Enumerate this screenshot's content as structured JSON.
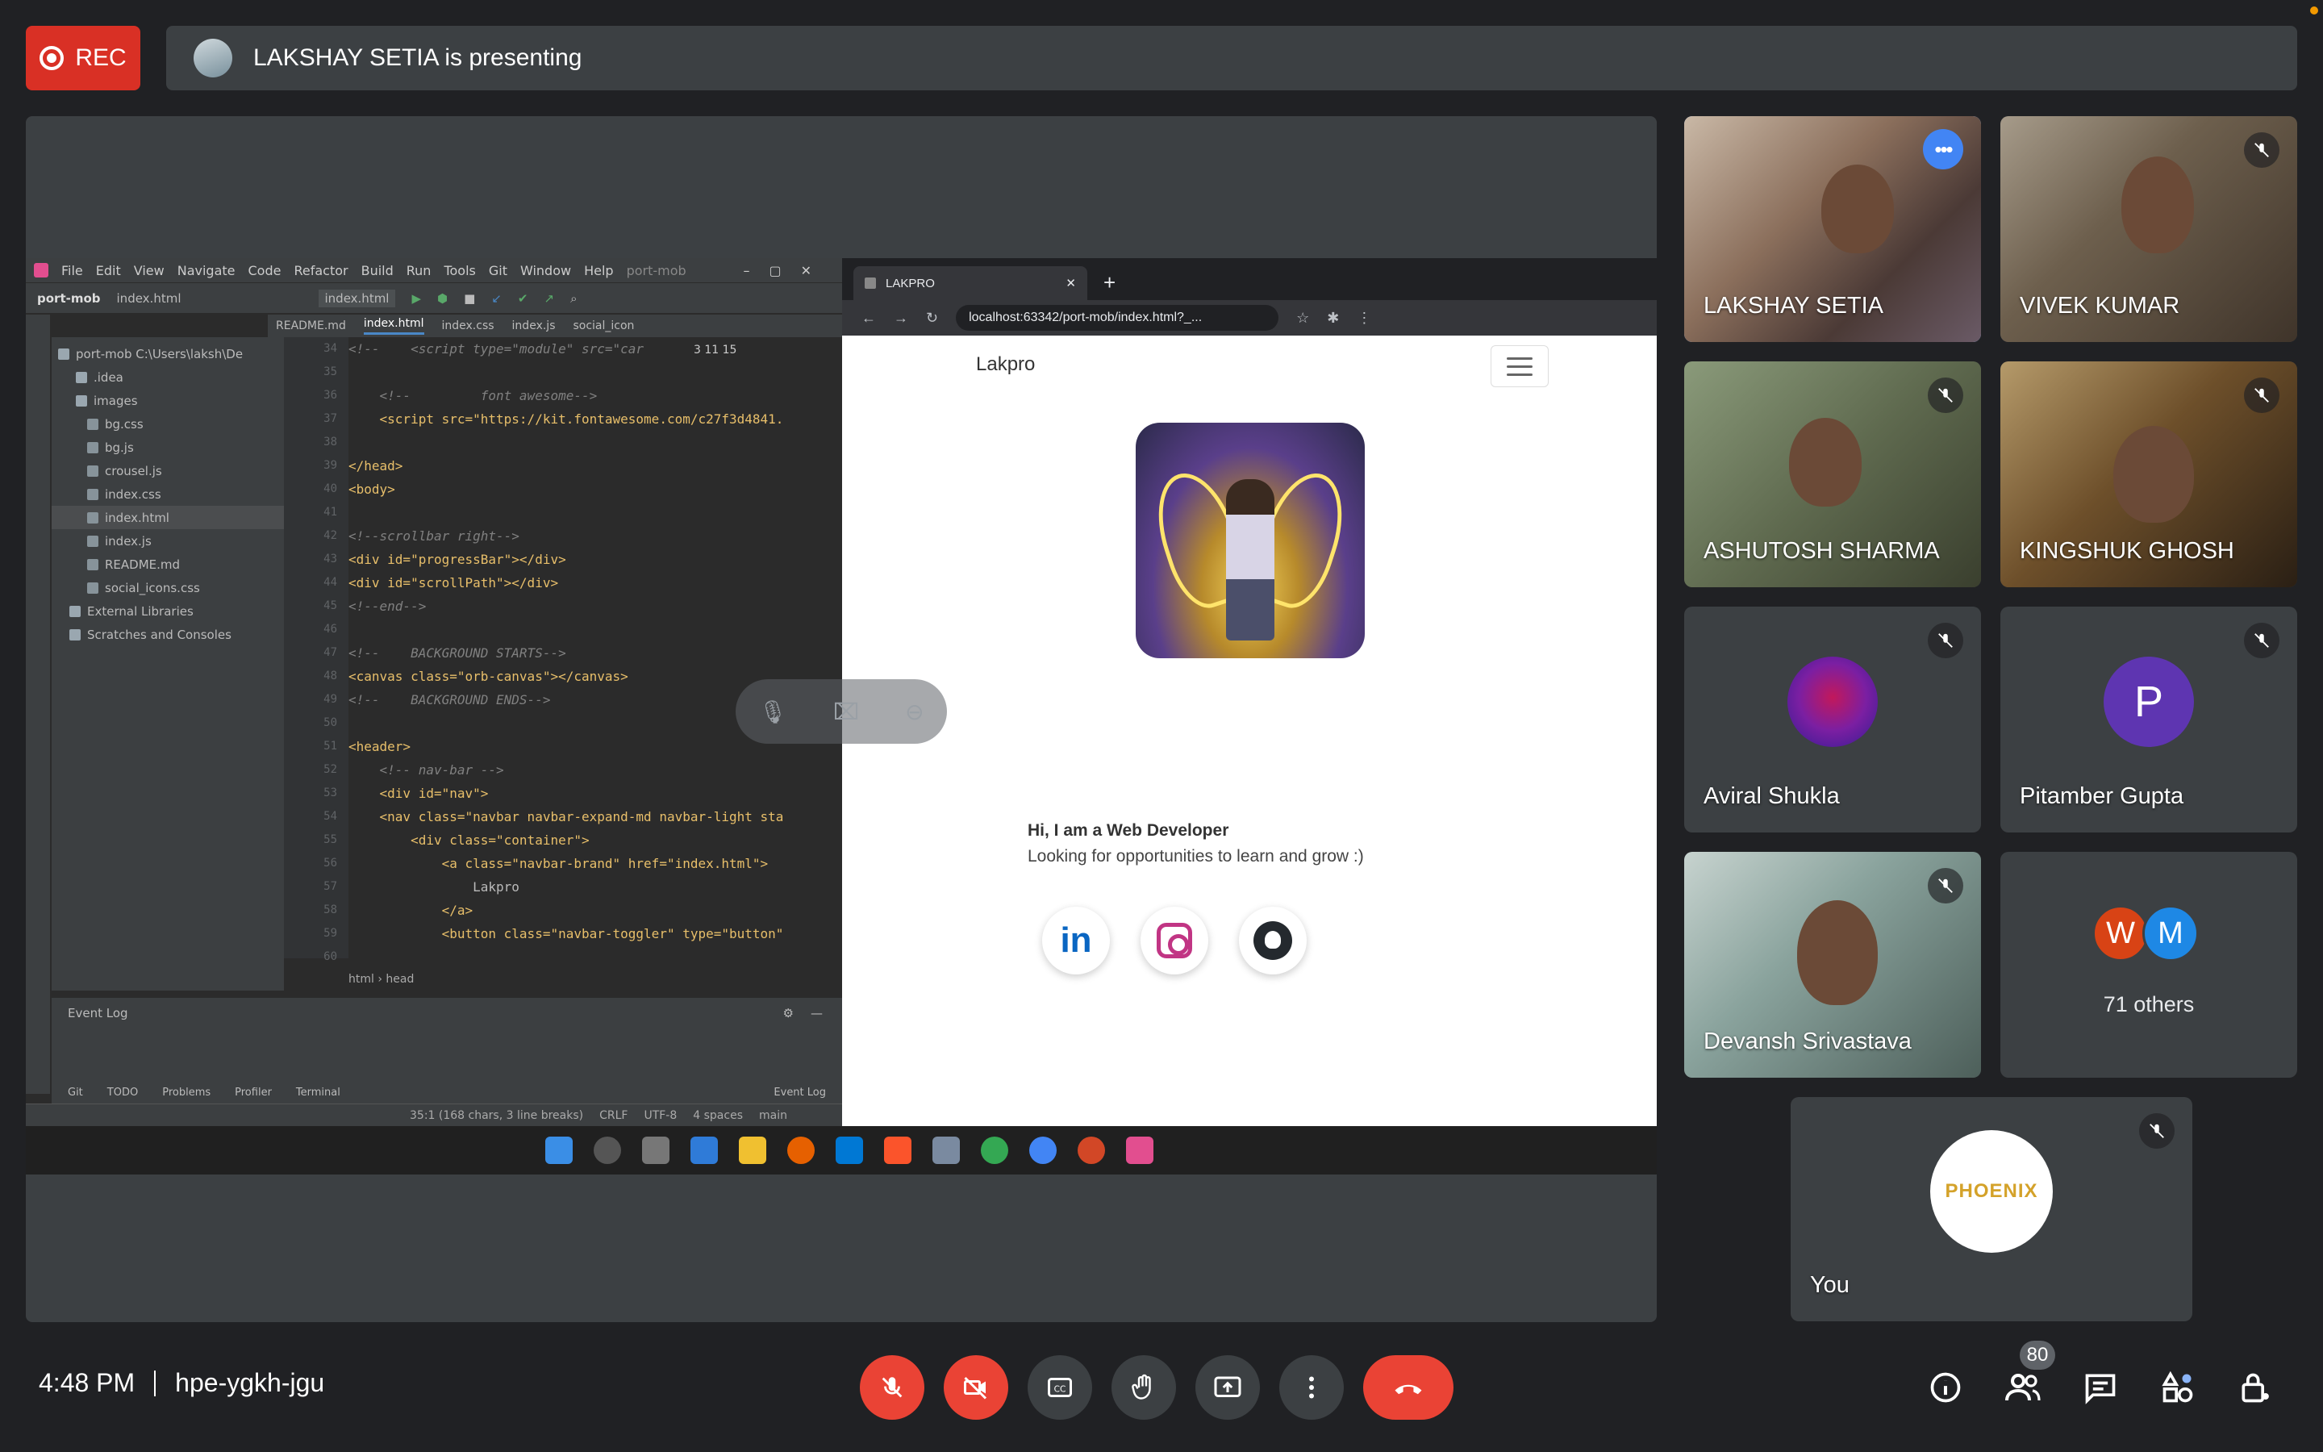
{
  "top": {
    "rec_label": "REC",
    "presenting_text": "LAKSHAY SETIA is presenting"
  },
  "ide": {
    "menu": [
      "File",
      "Edit",
      "View",
      "Navigate",
      "Code",
      "Refactor",
      "Build",
      "Run",
      "Tools",
      "Git",
      "Window",
      "Help",
      "port-mob"
    ],
    "toolbar_project": "port-mob",
    "toolbar_file": "index.html",
    "toolbar_run_file": "index.html",
    "tabs": [
      "README.md",
      "index.html",
      "index.css",
      "index.js",
      "social_icon"
    ],
    "tree": [
      {
        "label": "port-mob  C:\\Users\\laksh\\De",
        "type": "folder"
      },
      {
        "label": ".idea",
        "type": "folder"
      },
      {
        "label": "images",
        "type": "folder"
      },
      {
        "label": "bg.css",
        "type": "file"
      },
      {
        "label": "bg.js",
        "type": "file"
      },
      {
        "label": "crousel.js",
        "type": "file"
      },
      {
        "label": "index.css",
        "type": "file"
      },
      {
        "label": "index.html",
        "type": "file"
      },
      {
        "label": "index.js",
        "type": "file"
      },
      {
        "label": "README.md",
        "type": "file"
      },
      {
        "label": "social_icons.css",
        "type": "file"
      },
      {
        "label": "External Libraries",
        "type": "folder"
      },
      {
        "label": "Scratches and Consoles",
        "type": "folder"
      }
    ],
    "line_numbers": [
      "34",
      "35",
      "36",
      "37",
      "38",
      "39",
      "40",
      "41",
      "42",
      "43",
      "44",
      "45",
      "46",
      "47",
      "48",
      "49",
      "50",
      "51",
      "52",
      "53",
      "54",
      "55",
      "56",
      "57",
      "58",
      "59",
      "60"
    ],
    "code": [
      "<!--    <script type=\"module\" src=\"car",
      "",
      "    <!--         font awesome-->",
      "    <script src=\"https://kit.fontawesome.com/c27f3d4841.",
      "",
      "</head>",
      "<body>",
      "",
      "<!--scrollbar right-->",
      "<div id=\"progressBar\"></div>",
      "<div id=\"scrollPath\"></div>",
      "<!--end-->",
      "",
      "<!--    BACKGROUND STARTS-->",
      "<canvas class=\"orb-canvas\"></canvas>",
      "<!--    BACKGROUND ENDS-->",
      "",
      "<header>",
      "    <!-- nav-bar -->",
      "    <div id=\"nav\">",
      "    <nav class=\"navbar navbar-expand-md navbar-light sta",
      "        <div class=\"container\">",
      "            <a class=\"navbar-brand\" href=\"index.html\">",
      "                Lakpro",
      "            </a>",
      "            <button class=\"navbar-toggler\" type=\"button\"",
      ""
    ],
    "inspection": "3  11  15",
    "breadcrumb": "html  ›  head",
    "event_log_title": "Event Log",
    "bottom_tabs": [
      "Git",
      "TODO",
      "Problems",
      "Profiler",
      "Terminal"
    ],
    "event_log_button": "Event Log",
    "status": [
      "35:1 (168 chars, 3 line breaks)",
      "CRLF",
      "UTF-8",
      "4 spaces",
      "main"
    ]
  },
  "browser": {
    "tab_title": "LAKPRO",
    "url": "localhost:63342/port-mob/index.html?_...",
    "brand": "Lakpro",
    "intro_title": "Hi, I am a Web Developer",
    "intro_sub": "Looking for opportunities to learn and grow :)",
    "social": [
      "linkedin",
      "instagram",
      "github"
    ],
    "linkedin_text": "in"
  },
  "participants": [
    {
      "name": "LAKSHAY SETIA",
      "state": "speaking"
    },
    {
      "name": "VIVEK KUMAR",
      "state": "muted"
    },
    {
      "name": "ASHUTOSH SHARMA",
      "state": "muted"
    },
    {
      "name": "KINGSHUK GHOSH",
      "state": "muted"
    },
    {
      "name": "Aviral Shukla",
      "state": "muted"
    },
    {
      "name": "Pitamber Gupta",
      "state": "muted",
      "initial": "P"
    },
    {
      "name": "Devansh Srivastava",
      "state": "muted"
    }
  ],
  "others": {
    "initials": [
      "W",
      "M"
    ],
    "colors": [
      "#d84315",
      "#1e88e5"
    ],
    "label": "71 others"
  },
  "you": {
    "name": "You",
    "avatar_text": "PHOENIX"
  },
  "bottom": {
    "time": "4:48 PM",
    "meeting_code": "hpe-ygkh-jgu",
    "participant_count": "80"
  },
  "colors": {
    "background": "#202124",
    "surface": "#3c4043",
    "danger": "#ea4335",
    "accent": "#8ab4f8"
  }
}
